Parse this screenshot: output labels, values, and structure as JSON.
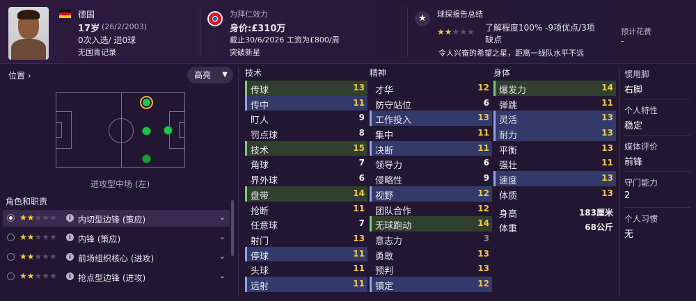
{
  "header": {
    "nationality": "德国",
    "age": "17岁",
    "birth_date": "(26/2/2003)",
    "caps_goals": "0次入选/ 进0球",
    "youth_record": "无国青记录",
    "club_line": "为拜仁效力",
    "value_label": "身价:£310万",
    "contract": "截止30/6/2026 工资为£800/周",
    "status": "突破新星",
    "scout_title": "球探报告总结",
    "knowledge": "了解程度100% -9项优点/3项",
    "knowledge_2": "缺点",
    "scout_summary": "令人兴奋的希望之星，距离一线队水平不远",
    "fee_label": "预计花费",
    "fee_value": "-",
    "scout_stars": 2,
    "scout_stars_max": 5
  },
  "position": {
    "label": "位置",
    "dropdown": "高亮",
    "position_name": "进攻型中场 (左)"
  },
  "roles": {
    "title": "角色和职责",
    "items": [
      {
        "name": "内切型边锋 (策应)",
        "stars": 2,
        "selected": true
      },
      {
        "name": "内锋 (策应)",
        "stars": 2,
        "selected": false
      },
      {
        "name": "前场组织核心 (进攻)",
        "stars": 2,
        "selected": false
      },
      {
        "name": "抢点型边锋 (进攻)",
        "stars": 2,
        "selected": false
      }
    ]
  },
  "attributes": {
    "technical": {
      "title": "技术",
      "items": [
        {
          "name": "传球",
          "value": "13",
          "hl": "green",
          "color": "yellow"
        },
        {
          "name": "传中",
          "value": "11",
          "hl": "blue",
          "color": "yellow"
        },
        {
          "name": "盯人",
          "value": "9",
          "hl": "",
          "color": "white"
        },
        {
          "name": "罚点球",
          "value": "8",
          "hl": "",
          "color": "white"
        },
        {
          "name": "技术",
          "value": "15",
          "hl": "green",
          "color": "yellow"
        },
        {
          "name": "角球",
          "value": "7",
          "hl": "",
          "color": "white"
        },
        {
          "name": "界外球",
          "value": "6",
          "hl": "",
          "color": "white"
        },
        {
          "name": "盘带",
          "value": "14",
          "hl": "green",
          "color": "yellow"
        },
        {
          "name": "抢断",
          "value": "11",
          "hl": "",
          "color": "yellow"
        },
        {
          "name": "任意球",
          "value": "7",
          "hl": "",
          "color": "white"
        },
        {
          "name": "射门",
          "value": "13",
          "hl": "",
          "color": "yellow"
        },
        {
          "name": "停球",
          "value": "11",
          "hl": "blue",
          "color": "yellow"
        },
        {
          "name": "头球",
          "value": "11",
          "hl": "",
          "color": "yellow"
        },
        {
          "name": "远射",
          "value": "11",
          "hl": "blue",
          "color": "yellow"
        }
      ]
    },
    "mental": {
      "title": "精神",
      "items": [
        {
          "name": "才华",
          "value": "12",
          "hl": "",
          "color": "yellow"
        },
        {
          "name": "防守站位",
          "value": "6",
          "hl": "",
          "color": "white"
        },
        {
          "name": "工作投入",
          "value": "13",
          "hl": "blue",
          "color": "yellow"
        },
        {
          "name": "集中",
          "value": "11",
          "hl": "",
          "color": "yellow"
        },
        {
          "name": "决断",
          "value": "11",
          "hl": "blue",
          "color": "yellow"
        },
        {
          "name": "领导力",
          "value": "6",
          "hl": "",
          "color": "white"
        },
        {
          "name": "侵略性",
          "value": "9",
          "hl": "",
          "color": "white"
        },
        {
          "name": "视野",
          "value": "12",
          "hl": "blue",
          "color": "yellow"
        },
        {
          "name": "团队合作",
          "value": "12",
          "hl": "",
          "color": "yellow"
        },
        {
          "name": "无球跑动",
          "value": "14",
          "hl": "green",
          "color": "yellow"
        },
        {
          "name": "意志力",
          "value": "3",
          "hl": "",
          "color": "grey"
        },
        {
          "name": "勇敢",
          "value": "13",
          "hl": "",
          "color": "yellow"
        },
        {
          "name": "预判",
          "value": "13",
          "hl": "",
          "color": "yellow"
        },
        {
          "name": "镇定",
          "value": "12",
          "hl": "blue",
          "color": "yellow"
        }
      ]
    },
    "physical": {
      "title": "身体",
      "items": [
        {
          "name": "爆发力",
          "value": "14",
          "hl": "green",
          "color": "yellow"
        },
        {
          "name": "弹跳",
          "value": "11",
          "hl": "",
          "color": "yellow"
        },
        {
          "name": "灵活",
          "value": "13",
          "hl": "blue",
          "color": "yellow"
        },
        {
          "name": "耐力",
          "value": "13",
          "hl": "blue",
          "color": "yellow"
        },
        {
          "name": "平衡",
          "value": "13",
          "hl": "",
          "color": "yellow"
        },
        {
          "name": "强壮",
          "value": "11",
          "hl": "",
          "color": "yellow"
        },
        {
          "name": "速度",
          "value": "13",
          "hl": "blue",
          "color": "yellow"
        },
        {
          "name": "体质",
          "value": "13",
          "hl": "",
          "color": "yellow"
        }
      ],
      "height_label": "身高",
      "height_value": "183厘米",
      "weight_label": "体重",
      "weight_value": "68公斤"
    }
  },
  "side": {
    "foot_label": "惯用脚",
    "foot_value": "右脚",
    "trait_label": "个人特性",
    "trait_value": "稳定",
    "media_label": "媒体评价",
    "media_value": "前锋",
    "gk_label": "守门能力",
    "gk_value": "2",
    "habit_label": "个人习惯",
    "habit_value": "无"
  },
  "colors": {
    "background": "#231632",
    "highlight_blue": "#333a6a",
    "highlight_green": "#31402e",
    "value_yellow": "#f0c945",
    "star_gold": "#f2c83c"
  }
}
